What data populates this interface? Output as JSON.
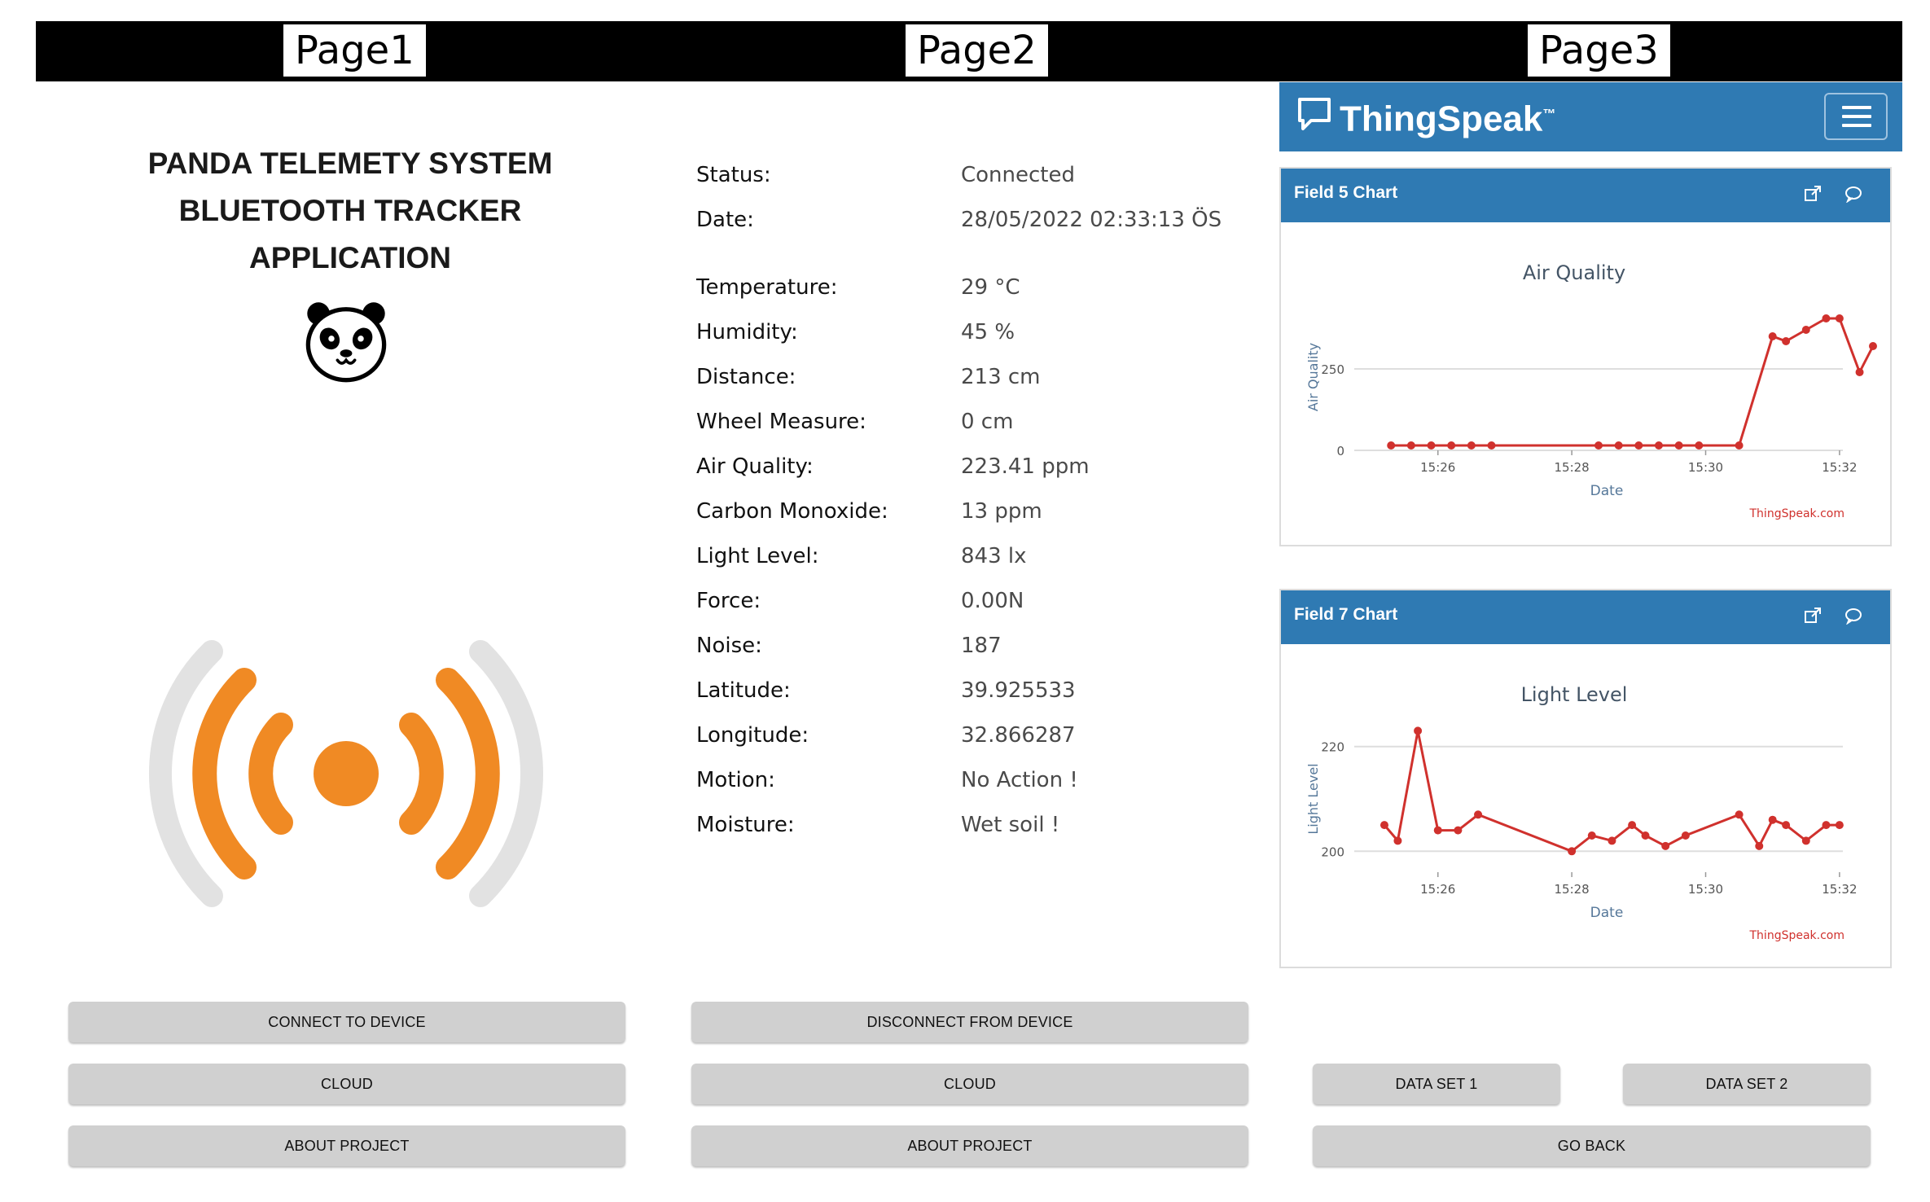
{
  "pages": {
    "page1_label": "Page1",
    "page2_label": "Page2",
    "page3_label": "Page3"
  },
  "page1": {
    "title_line1": "PANDA TELEMETY SYSTEM",
    "title_line2": "BLUETOOTH TRACKER",
    "title_line3": "APPLICATION",
    "buttons": {
      "connect": "CONNECT TO DEVICE",
      "cloud": "CLOUD",
      "about": "ABOUT PROJECT"
    },
    "colors": {
      "signal_accent": "#f08a24",
      "signal_outer": "#e2e2e2"
    },
    "icons": {
      "logo": "panda-icon",
      "signal": "bluetooth-signal-icon"
    }
  },
  "page2": {
    "readings": [
      {
        "label": "Status:",
        "value": "Connected"
      },
      {
        "label": "Date:",
        "value": "28/05/2022 02:33:13 ÖS"
      },
      {
        "label": "Temperature:",
        "value": "29 °C"
      },
      {
        "label": "Humidity:",
        "value": "45 %"
      },
      {
        "label": "Distance:",
        "value": "213 cm"
      },
      {
        "label": "Wheel Measure:",
        "value": "0 cm"
      },
      {
        "label": "Air Quality:",
        "value": "223.41 ppm"
      },
      {
        "label": "Carbon Monoxide:",
        "value": "13 ppm"
      },
      {
        "label": "Light Level:",
        "value": "843 lx"
      },
      {
        "label": "Force:",
        "value": "0.00N"
      },
      {
        "label": "Noise:",
        "value": "187"
      },
      {
        "label": "Latitude:",
        "value": "39.925533"
      },
      {
        "label": "Longitude:",
        "value": "32.866287"
      },
      {
        "label": "Motion:",
        "value": "No Action !"
      },
      {
        "label": "Moisture:",
        "value": "Wet soil !"
      }
    ],
    "buttons": {
      "disconnect": "DISCONNECT FROM DEVICE",
      "cloud": "CLOUD",
      "about": "ABOUT PROJECT"
    }
  },
  "page3": {
    "brand": "ThingSpeak",
    "brand_tm": "™",
    "colors": {
      "header": "#2f7ab3",
      "line": "#d0312d"
    },
    "buttons": {
      "dataset1": "DATA SET 1",
      "dataset2": "DATA SET 2",
      "goback": "GO BACK"
    }
  },
  "chart_data": [
    {
      "type": "line",
      "panel_title": "Field 5 Chart",
      "title": "Air Quality",
      "xlabel": "Date",
      "ylabel": "Air Quality",
      "credit": "ThingSpeak.com",
      "x_ticks": [
        "15:26",
        "15:28",
        "15:30",
        "15:32"
      ],
      "y_ticks": [
        0,
        250
      ],
      "ylim": [
        0,
        450
      ],
      "grid": true,
      "x": [
        "15:25.3",
        "15:25.6",
        "15:25.9",
        "15:26.2",
        "15:26.5",
        "15:26.8",
        "15:28.4",
        "15:28.7",
        "15:29.0",
        "15:29.3",
        "15:29.6",
        "15:29.9",
        "15:30.5",
        "15:31.0",
        "15:31.2",
        "15:31.5",
        "15:31.8",
        "15:32.0",
        "15:32.3",
        "15:32.5"
      ],
      "series": [
        {
          "values": [
            15,
            15,
            15,
            15,
            15,
            15,
            15,
            15,
            15,
            15,
            15,
            15,
            15,
            350,
            335,
            370,
            405,
            405,
            240,
            320
          ]
        }
      ]
    },
    {
      "type": "line",
      "panel_title": "Field 7 Chart",
      "title": "Light Level",
      "xlabel": "Date",
      "ylabel": "Light Level",
      "credit": "ThingSpeak.com",
      "x_ticks": [
        "15:26",
        "15:28",
        "15:30",
        "15:32"
      ],
      "y_ticks": [
        200,
        220
      ],
      "ylim": [
        196,
        224
      ],
      "grid": true,
      "x": [
        "15:25.2",
        "15:25.4",
        "15:25.7",
        "15:26.0",
        "15:26.3",
        "15:26.6",
        "15:28.0",
        "15:28.3",
        "15:28.6",
        "15:28.9",
        "15:29.1",
        "15:29.4",
        "15:29.7",
        "15:30.5",
        "15:30.8",
        "15:31.0",
        "15:31.2",
        "15:31.5",
        "15:31.8",
        "15:32.0"
      ],
      "series": [
        {
          "values": [
            205,
            202,
            223,
            204,
            204,
            207,
            200,
            203,
            202,
            205,
            203,
            201,
            203,
            207,
            201,
            206,
            205,
            202,
            205,
            205
          ]
        }
      ]
    }
  ]
}
